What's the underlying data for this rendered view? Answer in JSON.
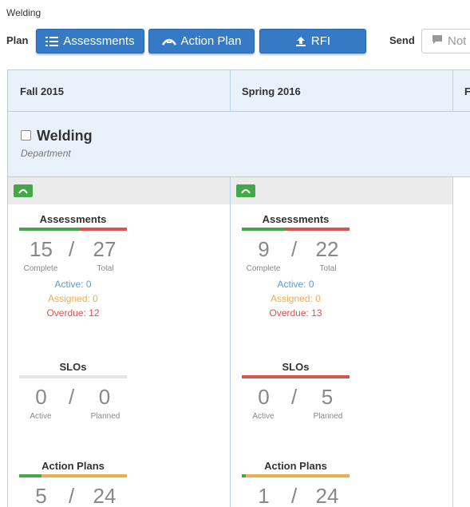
{
  "breadcrumb": "Welding",
  "toolbar": {
    "plan_label": "Plan",
    "assessments_btn": "Assessments",
    "action_plan_btn": "Action Plan",
    "rfi_btn": "RFI",
    "send_label": "Send",
    "notify_text": "Not"
  },
  "terms": [
    "Fall 2015",
    "Spring 2016",
    "F"
  ],
  "department": {
    "name": "Welding",
    "type": "Department",
    "checked": false
  },
  "colors": {
    "primary": "#3679c4",
    "green": "#44a84a",
    "red": "#d9534f",
    "orange": "#f0ad4e",
    "active_blue": "#5b9bd5"
  },
  "columns": [
    {
      "assessments": {
        "title": "Assessments",
        "complete": "15",
        "total": "27",
        "complete_label": "Complete",
        "total_label": "Total",
        "active": "Active: 0",
        "assigned": "Assigned: 0",
        "overdue": "Overdue: 12",
        "bar": [
          {
            "color": "green",
            "fraction": 0.56
          },
          {
            "color": "red",
            "fraction": 0.44
          }
        ]
      },
      "slos": {
        "title": "SLOs",
        "active": "0",
        "planned": "0",
        "active_label": "Active",
        "planned_label": "Planned",
        "bar": [
          {
            "color": "lightgray",
            "fraction": 1.0
          }
        ]
      },
      "action_plans": {
        "title": "Action Plans",
        "done": "5",
        "total": "24",
        "bar": [
          {
            "color": "green",
            "fraction": 0.21
          },
          {
            "color": "orange",
            "fraction": 0.79
          }
        ]
      }
    },
    {
      "assessments": {
        "title": "Assessments",
        "complete": "9",
        "total": "22",
        "complete_label": "Complete",
        "total_label": "Total",
        "active": "Active: 0",
        "assigned": "Assigned: 0",
        "overdue": "Overdue: 13",
        "bar": [
          {
            "color": "green",
            "fraction": 0.41
          },
          {
            "color": "red",
            "fraction": 0.59
          }
        ]
      },
      "slos": {
        "title": "SLOs",
        "active": "0",
        "planned": "5",
        "active_label": "Active",
        "planned_label": "Planned",
        "bar": [
          {
            "color": "red",
            "fraction": 1.0
          }
        ]
      },
      "action_plans": {
        "title": "Action Plans",
        "done": "1",
        "total": "24",
        "bar": [
          {
            "color": "green",
            "fraction": 0.04
          },
          {
            "color": "orange",
            "fraction": 0.96
          }
        ]
      }
    }
  ]
}
